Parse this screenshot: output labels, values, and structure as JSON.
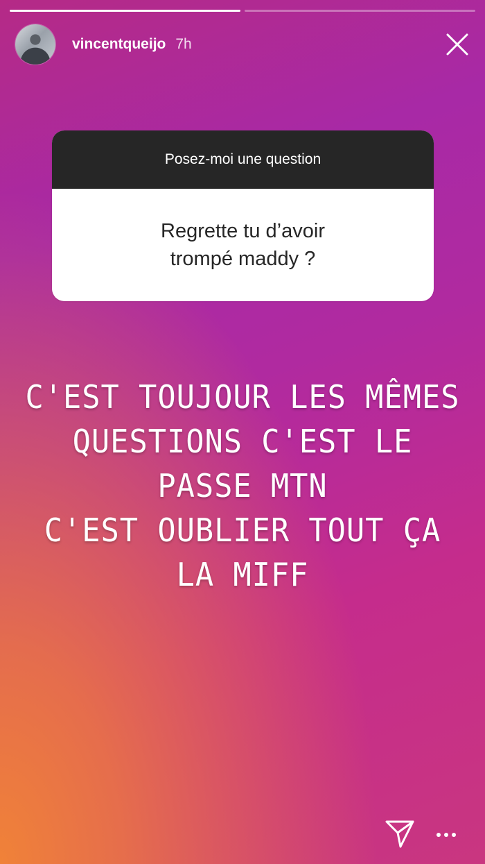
{
  "story": {
    "segments": 2,
    "progress": [
      1.0,
      0.0
    ]
  },
  "header": {
    "username": "vincentqueijo",
    "time": "7h",
    "avatar_icon": "avatar-photo",
    "close_icon": "close-icon"
  },
  "question_sticker": {
    "title": "Posez-moi une question",
    "question_line1": "Regrette tu d’avoir",
    "question_line2": "trompé maddy ?"
  },
  "overlay_text": {
    "line1": "C'est toujour les mêmes",
    "line2": "questions c'est le passe mtn",
    "line3": "C'est oublier tout ça la miff"
  },
  "footer": {
    "send_icon": "send-icon",
    "more_icon": "more-icon"
  },
  "colors": {
    "gradient_top": "#b52a86",
    "gradient_mid": "#a829a6",
    "gradient_bottom_left": "#f08238",
    "card_header_bg": "#262626",
    "card_body_bg": "#ffffff"
  }
}
